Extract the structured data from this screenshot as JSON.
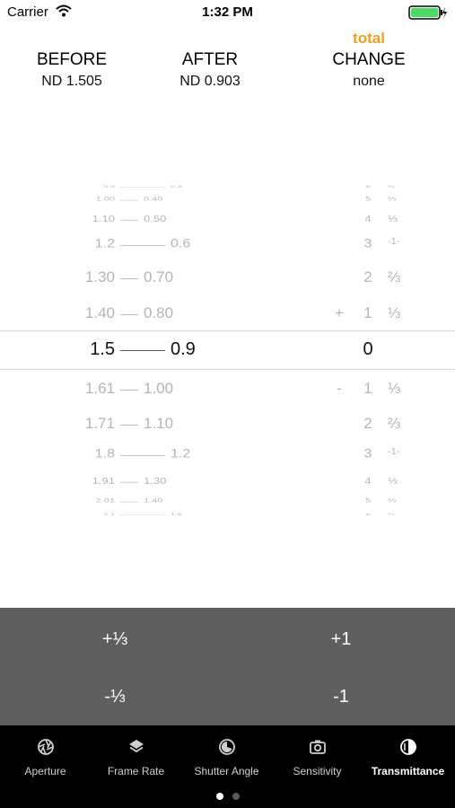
{
  "status_bar": {
    "carrier": "Carrier",
    "time": "1:32 PM"
  },
  "header": {
    "total_label": "total",
    "before": {
      "label": "BEFORE",
      "value": "ND 1.505"
    },
    "after": {
      "label": "AFTER",
      "value": "ND 0.903"
    },
    "change": {
      "label": "CHANGE",
      "value": "none"
    }
  },
  "picker_rows": [
    {
      "a": "0.9",
      "b": "0.3",
      "stops": "6",
      "frac": "⅔"
    },
    {
      "a": "1.00",
      "b": "0.40",
      "stops": "5",
      "frac": "⅔"
    },
    {
      "a": "1.10",
      "b": "0.50",
      "stops": "4",
      "frac": "⅓"
    },
    {
      "a": "1.2",
      "b": "0.6",
      "stops": "3",
      "frac": "-1-"
    },
    {
      "a": "1.30",
      "b": "0.70",
      "stops": "2",
      "frac": "⅔"
    },
    {
      "a": "1.40",
      "b": "0.80",
      "sign": "+",
      "stops": "1",
      "frac": "⅓"
    },
    {
      "a": "1.5",
      "b": "0.9",
      "stops": "0",
      "frac": ""
    },
    {
      "a": "1.61",
      "b": "1.00",
      "sign": "-",
      "stops": "1",
      "frac": "⅓"
    },
    {
      "a": "1.71",
      "b": "1.10",
      "stops": "2",
      "frac": "⅔"
    },
    {
      "a": "1.8",
      "b": "1.2",
      "stops": "3",
      "frac": "-1-"
    },
    {
      "a": "1.91",
      "b": "1.30",
      "stops": "4",
      "frac": "⅓"
    },
    {
      "a": "2.01",
      "b": "1.40",
      "stops": "5",
      "frac": "⅔"
    },
    {
      "a": "2.1",
      "b": "1.5",
      "stops": "6",
      "frac": "⅔"
    }
  ],
  "buttons": {
    "plus_third": "+⅓",
    "plus_one": "+1",
    "minus_third": "-⅓",
    "minus_one": "-1"
  },
  "tabs": [
    {
      "label": "Aperture",
      "icon": "aperture-icon"
    },
    {
      "label": "Frame Rate",
      "icon": "layers-icon"
    },
    {
      "label": "Shutter Angle",
      "icon": "shutter-icon"
    },
    {
      "label": "Sensitivity",
      "icon": "camera-icon"
    },
    {
      "label": "Transmittance",
      "icon": "half-circle-icon"
    }
  ],
  "active_tab": "Transmittance",
  "page_indicator": {
    "count": 2,
    "current": 1
  }
}
